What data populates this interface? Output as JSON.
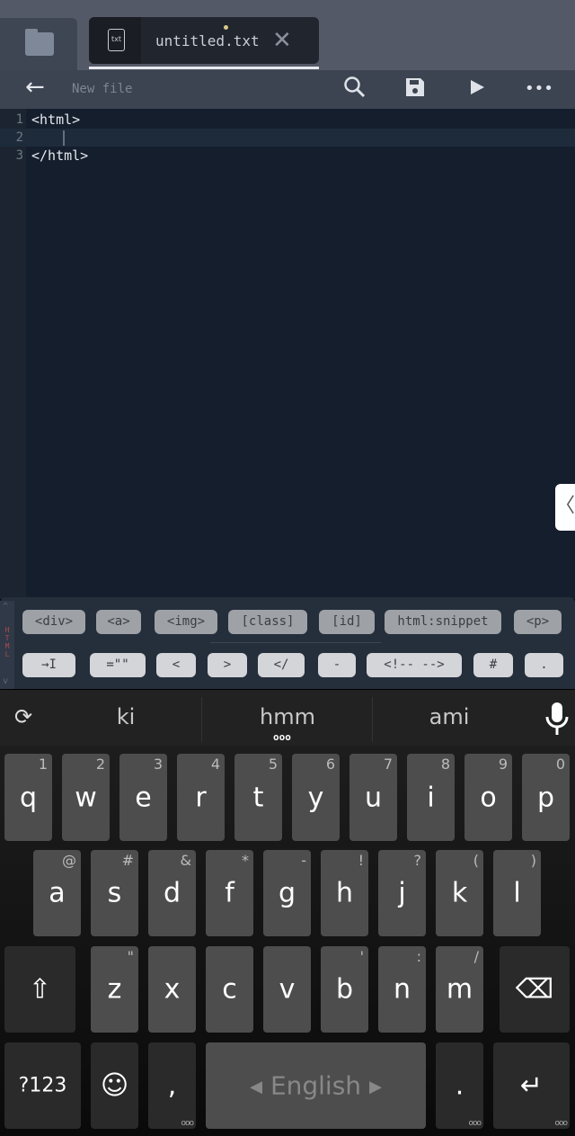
{
  "tabbar": {
    "tab_name": "untitled.txt",
    "file_icon_text": "txt",
    "close": "✕"
  },
  "toolbar": {
    "back": "←",
    "title": "New file",
    "search": "search-icon",
    "save": "save-icon",
    "run": "play-icon",
    "more": "•••"
  },
  "editor": {
    "lines": [
      {
        "n": "1",
        "code": "<html>"
      },
      {
        "n": "2",
        "code": ""
      },
      {
        "n": "3",
        "code": "</html>"
      }
    ],
    "handle": "〈"
  },
  "snippets": {
    "mode": "HTML",
    "row1": [
      "<div>",
      "<a>",
      "<img>",
      "[class]",
      "[id]",
      "html:snippet",
      "<p>"
    ],
    "row2": [
      "→I",
      "=\"\"",
      "<",
      ">",
      "</",
      "-",
      "<!-- -->",
      "#",
      "."
    ]
  },
  "keyboard": {
    "suggestions": [
      "ki",
      "hmm",
      "ami"
    ],
    "suggestion_more": "ooo",
    "row1": [
      {
        "k": "q",
        "h": "1"
      },
      {
        "k": "w",
        "h": "2"
      },
      {
        "k": "e",
        "h": "3"
      },
      {
        "k": "r",
        "h": "4"
      },
      {
        "k": "t",
        "h": "5"
      },
      {
        "k": "y",
        "h": "6"
      },
      {
        "k": "u",
        "h": "7"
      },
      {
        "k": "i",
        "h": "8"
      },
      {
        "k": "o",
        "h": "9"
      },
      {
        "k": "p",
        "h": "0"
      }
    ],
    "row2": [
      {
        "k": "a",
        "h": "@"
      },
      {
        "k": "s",
        "h": "#"
      },
      {
        "k": "d",
        "h": "&"
      },
      {
        "k": "f",
        "h": "*"
      },
      {
        "k": "g",
        "h": "-"
      },
      {
        "k": "h",
        "h": "!"
      },
      {
        "k": "j",
        "h": "?"
      },
      {
        "k": "k",
        "h": "("
      },
      {
        "k": "l",
        "h": ")"
      }
    ],
    "row3": [
      {
        "k": "z",
        "h": "\""
      },
      {
        "k": "x",
        "h": ""
      },
      {
        "k": "c",
        "h": ""
      },
      {
        "k": "v",
        "h": ""
      },
      {
        "k": "b",
        "h": "'"
      },
      {
        "k": "n",
        "h": ":"
      },
      {
        "k": "m",
        "h": "/"
      }
    ],
    "shift": "⇧",
    "backspace": "⌫",
    "symbols": "?123",
    "emoji": "☺",
    "comma": ",",
    "space": "◂ English ▸",
    "period": ".",
    "enter": "↵",
    "more": "ooo"
  }
}
